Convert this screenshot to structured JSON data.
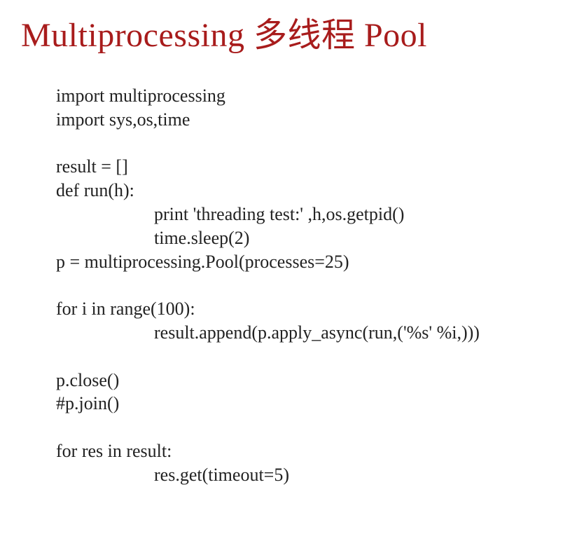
{
  "title": "Multiprocessing 多线程 Pool",
  "code": {
    "l1": "import multiprocessing",
    "l2": "import sys,os,time",
    "l3": "",
    "l4": "result = []",
    "l5": "def run(h):",
    "l6": "print 'threading test:' ,h,os.getpid()",
    "l7": "time.sleep(2)",
    "l8": "p = multiprocessing.Pool(processes=25)",
    "l9": "",
    "l10": "for i in range(100):",
    "l11": "result.append(p.apply_async(run,('%s' %i,)))",
    "l12": "",
    "l13": "p.close()",
    "l14": "#p.join()",
    "l15": "",
    "l16": "for res in result:",
    "l17": "res.get(timeout=5)"
  }
}
